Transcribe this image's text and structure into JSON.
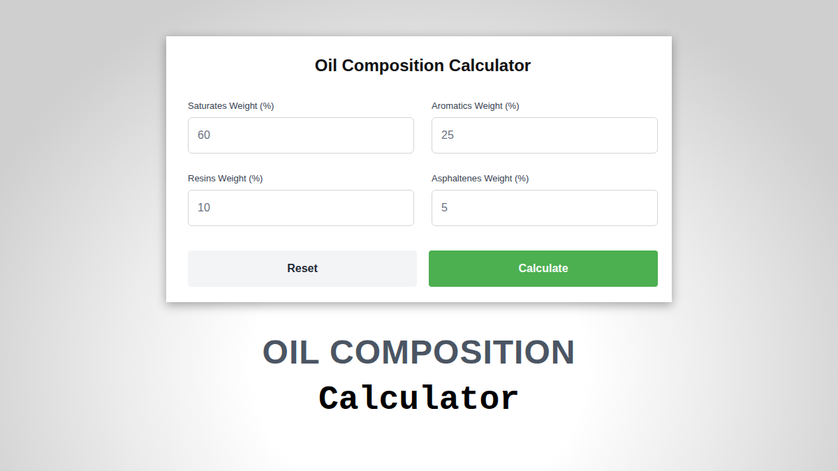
{
  "card": {
    "title": "Oil Composition Calculator",
    "fields": [
      {
        "label": "Saturates Weight (%)",
        "placeholder": "60"
      },
      {
        "label": "Aromatics Weight (%)",
        "placeholder": "25"
      },
      {
        "label": "Resins Weight (%)",
        "placeholder": "10"
      },
      {
        "label": "Asphaltenes Weight (%)",
        "placeholder": "5"
      }
    ],
    "buttons": [
      {
        "label": "Reset",
        "kind": "secondary"
      },
      {
        "label": "Calculate",
        "kind": "primary"
      }
    ]
  },
  "banner": {
    "heading": "OIL COMPOSITION",
    "subheading": "Calculator"
  }
}
